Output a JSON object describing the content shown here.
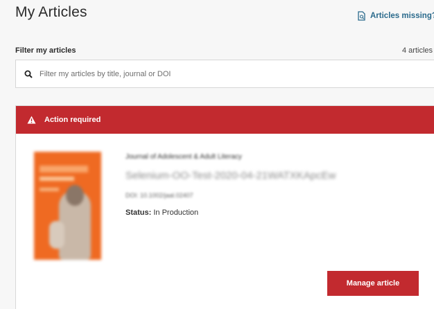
{
  "page": {
    "title": "My Articles"
  },
  "header": {
    "missing_link": "Articles missing?"
  },
  "filter": {
    "label": "Filter my articles",
    "count": "4 articles",
    "placeholder": "Filter my articles by title, journal or DOI"
  },
  "alert": {
    "text": "Action required"
  },
  "article": {
    "journal": "Journal of Adolescent & Adult Literacy",
    "title": "Selenium-OO-Test-2020-04-21WATXKApcEw",
    "doi_label": "DOI:",
    "doi": "10.1002/jaal.02407",
    "status_label": "Status:",
    "status_value": "In Production",
    "manage_label": "Manage article"
  },
  "icons": {
    "doc": "document-search-icon",
    "search": "search-icon",
    "warning": "warning-icon"
  },
  "colors": {
    "accent_red": "#c22a2f",
    "link_blue": "#2a6a8c",
    "cover_orange": "#ef6a22"
  }
}
